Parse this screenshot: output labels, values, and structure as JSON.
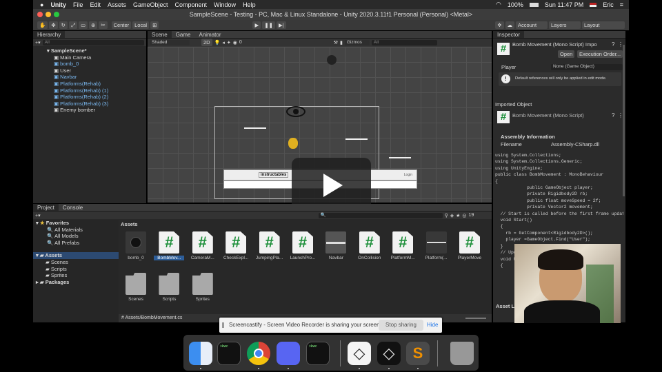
{
  "menubar": {
    "app": "Unity",
    "items": [
      "File",
      "Edit",
      "Assets",
      "GameObject",
      "Component",
      "Window",
      "Help"
    ],
    "battery": "100%",
    "time": "Sun 11:47 PM",
    "user": "Eric"
  },
  "window": {
    "title": "SampleScene - Testing - PC, Mac & Linux Standalone - Unity 2020.3.11f1 Personal (Personal) <Metal>"
  },
  "toolbar": {
    "center": "Center",
    "local": "Local",
    "account": "Account",
    "layers": "Layers",
    "layout": "Layout"
  },
  "hierarchy": {
    "tab": "Hierarchy",
    "search": "All",
    "scene": "SampleScene*",
    "items": [
      {
        "label": "Main Camera",
        "blue": false
      },
      {
        "label": "bomb_0",
        "blue": true
      },
      {
        "label": "User",
        "blue": false
      },
      {
        "label": "Navbar",
        "blue": true
      },
      {
        "label": "Platforms(Rehab)",
        "blue": true
      },
      {
        "label": "Platforms(Rehab) (1)",
        "blue": true
      },
      {
        "label": "Platforms(Rehab) (2)",
        "blue": true
      },
      {
        "label": "Platforms(Rehab) (3)",
        "blue": true
      },
      {
        "label": "Enemy bomber",
        "blue": false
      }
    ]
  },
  "scene": {
    "tabs": [
      "Scene",
      "Game",
      "Animator"
    ],
    "shaded": "Shaded",
    "mode2d": "2D",
    "gizmos": "Gizmos",
    "search": "All",
    "banner": "instructables",
    "login": "Login",
    "count0": "0"
  },
  "project": {
    "tabs": [
      "Project",
      "Console"
    ],
    "favorites": "Favorites",
    "fav_items": [
      "All Materials",
      "All Models",
      "All Prefabs"
    ],
    "assets": "Assets",
    "asset_folders": [
      "Scenes",
      "Scripts",
      "Sprites"
    ],
    "packages": "Packages",
    "header": "Assets",
    "path": "Assets/BombMovement.cs",
    "count": "19",
    "grid": [
      {
        "label": "bomb_0",
        "kind": "bomb"
      },
      {
        "label": "BombMov...",
        "kind": "doc"
      },
      {
        "label": "CameraM...",
        "kind": "doc"
      },
      {
        "label": "CheckExpl...",
        "kind": "doc"
      },
      {
        "label": "JumpingPla...",
        "kind": "doc"
      },
      {
        "label": "LaunchPro...",
        "kind": "doc"
      },
      {
        "label": "Navbar",
        "kind": "navbar"
      },
      {
        "label": "OnCollision",
        "kind": "doc"
      },
      {
        "label": "PlatformM...",
        "kind": "doc"
      },
      {
        "label": "Platform(...",
        "kind": "plat"
      },
      {
        "label": "PlayerMove",
        "kind": "doc"
      },
      {
        "label": "Scenes",
        "kind": "folder"
      },
      {
        "label": "Scripts",
        "kind": "folder"
      },
      {
        "label": "Sprites",
        "kind": "folder"
      }
    ]
  },
  "inspector": {
    "tab": "Inspector",
    "title": "Bomb Movement (Mono Script) Impo",
    "open": "Open",
    "exec": "Execution Order...",
    "player_label": "Player",
    "player_value": "None (Game Object)",
    "warning": "Default references will only be applied in edit mode.",
    "imported": "Imported Object",
    "imported_title": "Bomb Movement (Mono Script)",
    "assembly": "Assembly Information",
    "filename_label": "Filename",
    "filename_value": "Assembly-CSharp.dll",
    "asset_label": "Asset L",
    "code": [
      "using System.Collections;",
      "using System.Collections.Generic;",
      "using UnityEngine;",
      "",
      "public class BombMovement : MonoBehaviour",
      "{",
      "            public GameObject player;",
      "            private Rigidbody2D rb;",
      "            public float moveSpeed = 2f;",
      "            private Vector2 movement;",
      "  // Start is called before the first frame update",
      "  void Start()",
      "  {",
      "    rb = GetComponent<Rigidbody2D>();",
      "    player =GameObject.Find(\"User\");",
      "  }",
      "",
      "",
      "  // Upd",
      "  void U",
      "  {"
    ]
  },
  "play": {
    "play": "▶",
    "pause": "❚❚",
    "step": "▶|"
  },
  "screencastify": {
    "message": "Screencastify - Screen Video Recorder is sharing your screen.",
    "stop": "Stop sharing",
    "hide": "Hide"
  },
  "dock": {
    "terminal": ">kwc"
  }
}
